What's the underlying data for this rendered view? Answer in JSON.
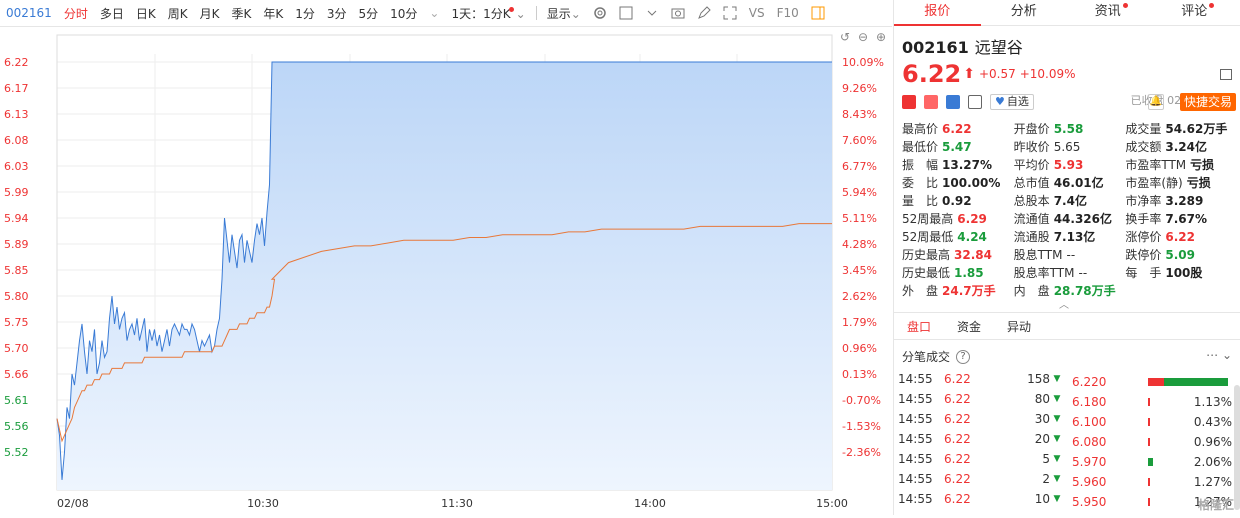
{
  "toolbar": {
    "code": "002161",
    "items": [
      "分时",
      "多日",
      "日K",
      "周K",
      "月K",
      "季K",
      "年K",
      "1分",
      "3分",
      "5分",
      "10分"
    ],
    "combo": "1天：1分K",
    "display": "显示",
    "vs": "VS",
    "f10": "F10"
  },
  "tabs": [
    "报价",
    "分析",
    "资讯",
    "评论"
  ],
  "stock": {
    "code": "002161",
    "name": "远望谷",
    "price": "6.22",
    "change": "+0.57",
    "change_pct": "+10.09%",
    "status": "已收盘 02/08 15:00",
    "watch_label": "自选",
    "quick_trade": "快捷交易"
  },
  "quote": [
    [
      {
        "l": "最高价",
        "v": "6.22",
        "c": "red"
      },
      {
        "l": "开盘价",
        "v": "5.58",
        "c": "green"
      },
      {
        "l": "成交量",
        "v": "54.62万手",
        "c": "blk"
      }
    ],
    [
      {
        "l": "最低价",
        "v": "5.47",
        "c": "green"
      },
      {
        "l": "昨收价",
        "v": "5.65",
        "c": "norm"
      },
      {
        "l": "成交额",
        "v": "3.24亿",
        "c": "blk"
      }
    ],
    [
      {
        "l": "振　幅",
        "v": "13.27%",
        "c": "blk"
      },
      {
        "l": "平均价",
        "v": "5.93",
        "c": "red"
      },
      {
        "l": "市盈率TTM",
        "v": "亏损",
        "c": "blk"
      }
    ],
    [
      {
        "l": "委　比",
        "v": "100.00%",
        "c": "blk"
      },
      {
        "l": "总市值",
        "v": "46.01亿",
        "c": "blk"
      },
      {
        "l": "市盈率(静)",
        "v": "亏损",
        "c": "blk"
      }
    ],
    [
      {
        "l": "量　比",
        "v": "0.92",
        "c": "blk"
      },
      {
        "l": "总股本",
        "v": "7.4亿",
        "c": "blk"
      },
      {
        "l": "市净率",
        "v": "3.289",
        "c": "blk"
      }
    ],
    [
      {
        "l": "52周最高",
        "v": "6.29",
        "c": "red"
      },
      {
        "l": "流通值",
        "v": "44.326亿",
        "c": "blk"
      },
      {
        "l": "换手率",
        "v": "7.67%",
        "c": "blk"
      }
    ],
    [
      {
        "l": "52周最低",
        "v": "4.24",
        "c": "green"
      },
      {
        "l": "流通股",
        "v": "7.13亿",
        "c": "blk"
      },
      {
        "l": "涨停价",
        "v": "6.22",
        "c": "red"
      }
    ],
    [
      {
        "l": "历史最高",
        "v": "32.84",
        "c": "red"
      },
      {
        "l": "股息TTM",
        "v": "--",
        "c": "norm"
      },
      {
        "l": "跌停价",
        "v": "5.09",
        "c": "green"
      }
    ],
    [
      {
        "l": "历史最低",
        "v": "1.85",
        "c": "green"
      },
      {
        "l": "股息率TTM",
        "v": "--",
        "c": "norm"
      },
      {
        "l": "每　手",
        "v": "100股",
        "c": "blk"
      }
    ],
    [
      {
        "l": "外　盘",
        "v": "24.7万手",
        "c": "red"
      },
      {
        "l": "内　盘",
        "v": "28.78万手",
        "c": "green"
      },
      {
        "l": "",
        "v": "",
        "c": "norm"
      }
    ]
  ],
  "subtabs": [
    "盘口",
    "资金",
    "异动"
  ],
  "trades_title": "分笔成交",
  "trades": [
    {
      "t": "14:55",
      "p": "6.22",
      "v": "158"
    },
    {
      "t": "14:55",
      "p": "6.22",
      "v": "80"
    },
    {
      "t": "14:55",
      "p": "6.22",
      "v": "30"
    },
    {
      "t": "14:55",
      "p": "6.22",
      "v": "20"
    },
    {
      "t": "14:55",
      "p": "6.22",
      "v": "5"
    },
    {
      "t": "14:55",
      "p": "6.22",
      "v": "2"
    },
    {
      "t": "14:55",
      "p": "6.22",
      "v": "10"
    }
  ],
  "depth": [
    {
      "p": "6.220",
      "pct": "",
      "c": "#e33"
    },
    {
      "p": "6.180",
      "pct": "1.13%",
      "c": "#e33"
    },
    {
      "p": "6.100",
      "pct": "0.43%",
      "c": "#e33"
    },
    {
      "p": "6.080",
      "pct": "0.96%",
      "c": "#e33"
    },
    {
      "p": "5.970",
      "pct": "2.06%",
      "c": "#1a9c3c"
    },
    {
      "p": "5.960",
      "pct": "1.27%",
      "c": "#e33"
    },
    {
      "p": "5.950",
      "pct": "1.27%",
      "c": "#e33"
    }
  ],
  "watermark": "格隆汇",
  "chart_data": {
    "type": "line",
    "left_ticks": [
      "6.22",
      "6.17",
      "6.13",
      "6.08",
      "6.03",
      "5.99",
      "5.94",
      "5.89",
      "5.85",
      "5.80",
      "5.75",
      "5.70",
      "5.66",
      "5.61",
      "5.56",
      "5.52"
    ],
    "right_ticks": [
      "10.09%",
      "9.26%",
      "8.43%",
      "7.60%",
      "6.77%",
      "5.94%",
      "5.11%",
      "4.28%",
      "3.45%",
      "2.62%",
      "1.79%",
      "0.96%",
      "0.13%",
      "-0.70%",
      "-1.53%",
      "-2.36%"
    ],
    "x_ticks": [
      "02/08",
      "10:30",
      "11:30",
      "14:00",
      "15:00"
    ],
    "ylim": [
      5.47,
      6.24
    ],
    "series": [
      {
        "values": [
          5.58,
          5.55,
          5.47,
          5.52,
          5.6,
          5.58,
          5.66,
          5.64,
          5.68,
          5.72,
          5.75,
          5.7,
          5.66,
          5.72,
          5.7,
          5.74,
          5.66,
          5.68,
          5.72,
          5.69,
          5.7,
          5.76,
          5.8,
          5.75,
          5.78,
          5.74,
          5.76,
          5.77,
          5.72,
          5.74,
          5.75,
          5.73,
          5.76,
          5.72,
          5.74,
          5.76,
          5.7,
          5.74,
          5.72,
          5.74,
          5.71,
          5.73,
          5.7,
          5.72,
          5.74,
          5.71,
          5.74,
          5.75,
          5.74,
          5.73,
          5.75,
          5.74,
          5.74,
          5.73,
          5.75,
          5.74,
          5.72,
          5.7,
          5.72,
          5.71,
          5.72,
          5.73,
          5.7,
          5.71,
          5.74,
          5.76,
          5.83,
          5.94,
          5.9,
          5.86,
          5.91,
          5.88,
          5.85,
          5.9,
          5.91,
          5.86,
          5.9,
          5.88,
          5.86,
          5.9,
          5.93,
          5.91,
          5.94,
          5.89,
          5.95,
          6.0,
          6.22
        ]
      },
      {
        "values": [
          5.58,
          5.56,
          5.54,
          5.55,
          5.56,
          5.57,
          5.58,
          5.6,
          5.61,
          5.62,
          5.63,
          5.63,
          5.64,
          5.64,
          5.64,
          5.65,
          5.65,
          5.65,
          5.66,
          5.66,
          5.66,
          5.66,
          5.67,
          5.67,
          5.67,
          5.67,
          5.67,
          5.68,
          5.68,
          5.68,
          5.68,
          5.68,
          5.68,
          5.68,
          5.68,
          5.69,
          5.69,
          5.69,
          5.69,
          5.69,
          5.69,
          5.69,
          5.69,
          5.69,
          5.69,
          5.69,
          5.69,
          5.69,
          5.69,
          5.69,
          5.69,
          5.7,
          5.7,
          5.7,
          5.7,
          5.7,
          5.7,
          5.7,
          5.7,
          5.7,
          5.7,
          5.7,
          5.7,
          5.71,
          5.71,
          5.71,
          5.71,
          5.72,
          5.73,
          5.74,
          5.74,
          5.74,
          5.74,
          5.75,
          5.75,
          5.75,
          5.75,
          5.76,
          5.76,
          5.76,
          5.77,
          5.77,
          5.77,
          5.77,
          5.78,
          5.78,
          5.8,
          5.83
        ]
      }
    ],
    "after_flat_price": 6.22,
    "avg_after": [
      5.83,
      5.86,
      5.87,
      5.88,
      5.885,
      5.89,
      5.89,
      5.895,
      5.9,
      5.9,
      5.9,
      5.9,
      5.905,
      5.905,
      5.91,
      5.91,
      5.91,
      5.91,
      5.915,
      5.915,
      5.92,
      5.92,
      5.92,
      5.92,
      5.92,
      5.92,
      5.925,
      5.925,
      5.925,
      5.925,
      5.925,
      5.925,
      5.93,
      5.93,
      5.93
    ]
  }
}
